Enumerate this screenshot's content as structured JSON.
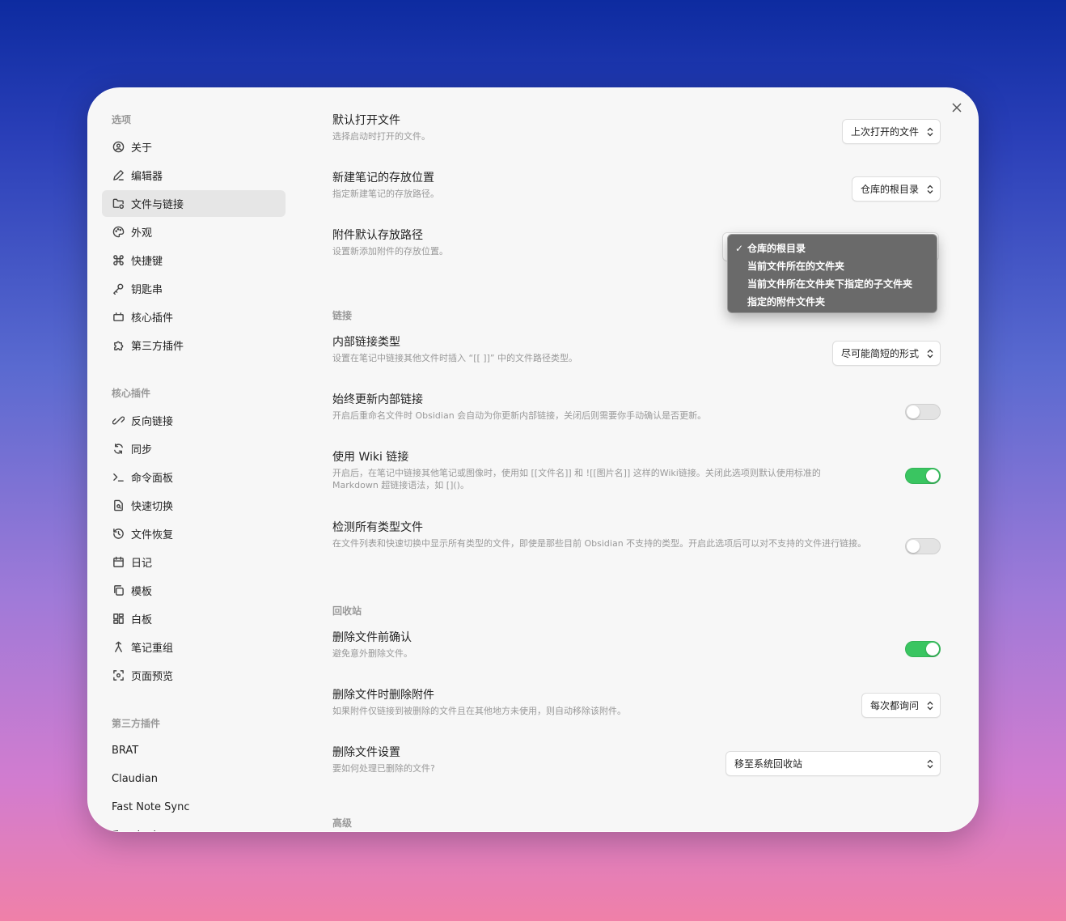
{
  "sidebar": {
    "options_header": "选项",
    "options": [
      {
        "label": "关于",
        "icon": "user-circle-icon"
      },
      {
        "label": "编辑器",
        "icon": "pencil-icon"
      },
      {
        "label": "文件与链接",
        "icon": "folder-link-icon",
        "active": true
      },
      {
        "label": "外观",
        "icon": "palette-icon"
      },
      {
        "label": "快捷键",
        "icon": "command-icon"
      },
      {
        "label": "钥匙串",
        "icon": "key-icon"
      },
      {
        "label": "核心插件",
        "icon": "plug-icon"
      },
      {
        "label": "第三方插件",
        "icon": "puzzle-icon"
      }
    ],
    "core_header": "核心插件",
    "core": [
      {
        "label": "反向链接",
        "icon": "backlink-icon"
      },
      {
        "label": "同步",
        "icon": "sync-icon"
      },
      {
        "label": "命令面板",
        "icon": "terminal-icon"
      },
      {
        "label": "快速切换",
        "icon": "file-search-icon"
      },
      {
        "label": "文件恢复",
        "icon": "history-icon"
      },
      {
        "label": "日记",
        "icon": "calendar-icon"
      },
      {
        "label": "模板",
        "icon": "copy-icon"
      },
      {
        "label": "白板",
        "icon": "canvas-icon"
      },
      {
        "label": "笔记重组",
        "icon": "merge-icon"
      },
      {
        "label": "页面预览",
        "icon": "preview-icon"
      }
    ],
    "community_header": "第三方插件",
    "community": [
      "BRAT",
      "Claudian",
      "Fast Note Sync",
      "Terminal"
    ]
  },
  "main": {
    "settings": [
      {
        "name": "默认打开文件",
        "desc": "选择启动时打开的文件。",
        "control": "select",
        "value": "上次打开的文件"
      },
      {
        "name": "新建笔记的存放位置",
        "desc": "指定新建笔记的存放路径。",
        "control": "select",
        "value": "仓库的根目录"
      },
      {
        "name": "附件默认存放路径",
        "desc": "设置新添加附件的存放位置。",
        "control": "dropdown-open"
      },
      {
        "name": "内部链接类型",
        "desc": "设置在笔记中链接其他文件时插入 “[[ ]]” 中的文件路径类型。",
        "control": "select",
        "value": "尽可能简短的形式"
      },
      {
        "name": "始终更新内部链接",
        "desc": "开启后重命名文件时 Obsidian 会自动为你更新内部链接，关闭后则需要你手动确认是否更新。",
        "control": "toggle",
        "on": false
      },
      {
        "name": "使用 Wiki 链接",
        "desc": "开启后，在笔记中链接其他笔记或图像时，使用如 [[文件名]] 和 ![[图片名]] 这样的Wiki链接。关闭此选项则默认使用标准的 Markdown 超链接语法，如 []()。",
        "control": "toggle",
        "on": true
      },
      {
        "name": "检测所有类型文件",
        "desc": "在文件列表和快速切换中显示所有类型的文件，即使是那些目前 Obsidian 不支持的类型。开启此选项后可以对不支持的文件进行链接。",
        "control": "toggle",
        "on": false
      },
      {
        "name": "删除文件前确认",
        "desc": "避免意外删除文件。",
        "control": "toggle",
        "on": true
      },
      {
        "name": "删除文件时删除附件",
        "desc": "如果附件仅链接到被删除的文件且在其他地方未使用，则自动移除该附件。",
        "control": "select",
        "value": "每次都询问"
      },
      {
        "name": "删除文件设置",
        "desc": "要如何处理已删除的文件?",
        "control": "select",
        "value": "移至系统回收站"
      }
    ],
    "sections": {
      "links": "链接",
      "trash": "回收站",
      "advanced": "高级"
    },
    "dropdown": {
      "options": [
        "仓库的根目录",
        "当前文件所在的文件夹",
        "当前文件所在文件夹下指定的子文件夹",
        "指定的附件文件夹"
      ],
      "selected_index": 0,
      "check": "✓"
    }
  }
}
